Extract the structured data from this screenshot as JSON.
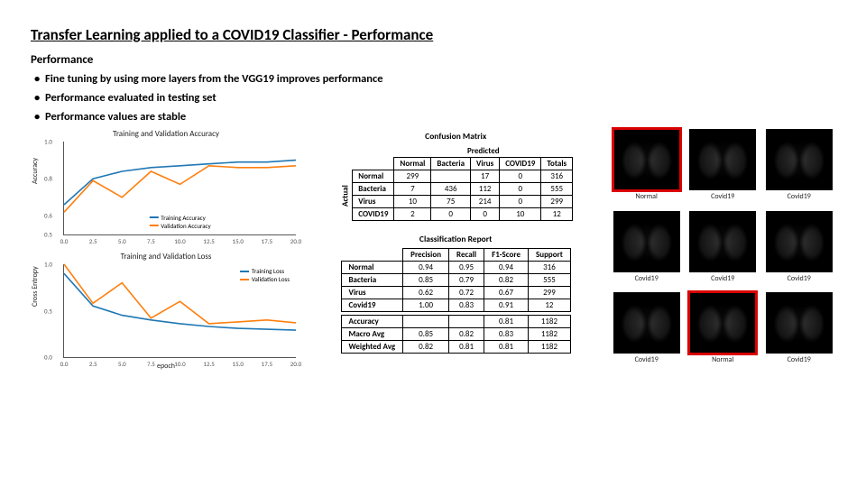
{
  "title": "Transfer Learning applied to a COVID19 Classifier - Performance",
  "subtitle": "Performance",
  "bullets": [
    "Fine tuning by using more layers from the VGG19 improves performance",
    "Performance evaluated in testing set",
    "Performance values are stable"
  ],
  "chart_data": [
    {
      "type": "line",
      "title": "Training and Validation Accuracy",
      "xlabel": "",
      "ylabel": "Accuracy",
      "x": [
        0.0,
        2.5,
        5.0,
        7.5,
        10.0,
        12.5,
        15.0,
        17.5,
        20.0
      ],
      "xlim": [
        0,
        20
      ],
      "ylim": [
        0.5,
        1.0
      ],
      "yticks": [
        0.5,
        0.6,
        0.8,
        1.0
      ],
      "series": [
        {
          "name": "Training Accuracy",
          "color": "#1f77b4",
          "values": [
            0.66,
            0.8,
            0.84,
            0.86,
            0.87,
            0.88,
            0.89,
            0.89,
            0.9
          ]
        },
        {
          "name": "Validation Accuracy",
          "color": "#ff7f0e",
          "values": [
            0.62,
            0.79,
            0.7,
            0.84,
            0.77,
            0.87,
            0.86,
            0.86,
            0.87
          ]
        }
      ],
      "legend_pos": "lower-center"
    },
    {
      "type": "line",
      "title": "Training and Validation Loss",
      "xlabel": "epoch",
      "ylabel": "Cross Entropy",
      "x": [
        0.0,
        2.5,
        5.0,
        7.5,
        10.0,
        12.5,
        15.0,
        17.5,
        20.0
      ],
      "xlim": [
        0,
        20
      ],
      "ylim": [
        0.0,
        1.0
      ],
      "yticks": [
        0.0,
        0.5,
        1.0
      ],
      "series": [
        {
          "name": "Training Loss",
          "color": "#1f77b4",
          "values": [
            0.9,
            0.55,
            0.45,
            0.4,
            0.36,
            0.33,
            0.31,
            0.3,
            0.29
          ]
        },
        {
          "name": "Validation Loss",
          "color": "#ff7f0e",
          "values": [
            1.0,
            0.58,
            0.8,
            0.42,
            0.6,
            0.36,
            0.38,
            0.4,
            0.37
          ]
        }
      ],
      "legend_pos": "upper-right"
    }
  ],
  "confusion_matrix": {
    "title": "Confusion Matrix",
    "predicted_label": "Predicted",
    "actual_label": "Actual",
    "cols": [
      "Normal",
      "Bacteria",
      "Virus",
      "COVID19",
      "Totals"
    ],
    "rows": [
      {
        "label": "Normal",
        "vals": [
          "299",
          "",
          "17",
          "0",
          "316"
        ]
      },
      {
        "label": "Bacteria",
        "vals": [
          "7",
          "436",
          "112",
          "0",
          "555"
        ]
      },
      {
        "label": "Virus",
        "vals": [
          "10",
          "75",
          "214",
          "0",
          "299"
        ]
      },
      {
        "label": "COVID19",
        "vals": [
          "2",
          "0",
          "0",
          "10",
          "12"
        ]
      }
    ]
  },
  "classification_report": {
    "title": "Classification Report",
    "cols": [
      "Precision",
      "Recall",
      "F1-Score",
      "Support"
    ],
    "rows": [
      {
        "label": "Normal",
        "vals": [
          "0.94",
          "0.95",
          "0.94",
          "316"
        ]
      },
      {
        "label": "Bacteria",
        "vals": [
          "0.85",
          "0.79",
          "0.82",
          "555"
        ]
      },
      {
        "label": "Virus",
        "vals": [
          "0.62",
          "0.72",
          "0.67",
          "299"
        ]
      },
      {
        "label": "Covid19",
        "vals": [
          "1.00",
          "0.83",
          "0.91",
          "12"
        ]
      }
    ],
    "summary": [
      {
        "label": "Accuracy",
        "vals": [
          "",
          "",
          "0.81",
          "1182"
        ]
      },
      {
        "label": "Macro Avg",
        "vals": [
          "0.85",
          "0.82",
          "0.83",
          "1182"
        ]
      },
      {
        "label": "Weighted Avg",
        "vals": [
          "0.82",
          "0.81",
          "0.81",
          "1182"
        ]
      }
    ]
  },
  "xray_grid": [
    {
      "label": "Normal",
      "highlight": true
    },
    {
      "label": "Covid19",
      "highlight": false
    },
    {
      "label": "Covid19",
      "highlight": false
    },
    {
      "label": "Covid19",
      "highlight": false
    },
    {
      "label": "Covid19",
      "highlight": false
    },
    {
      "label": "Covid19",
      "highlight": false
    },
    {
      "label": "Covid19",
      "highlight": false
    },
    {
      "label": "Normal",
      "highlight": true
    },
    {
      "label": "Covid19",
      "highlight": false
    }
  ]
}
